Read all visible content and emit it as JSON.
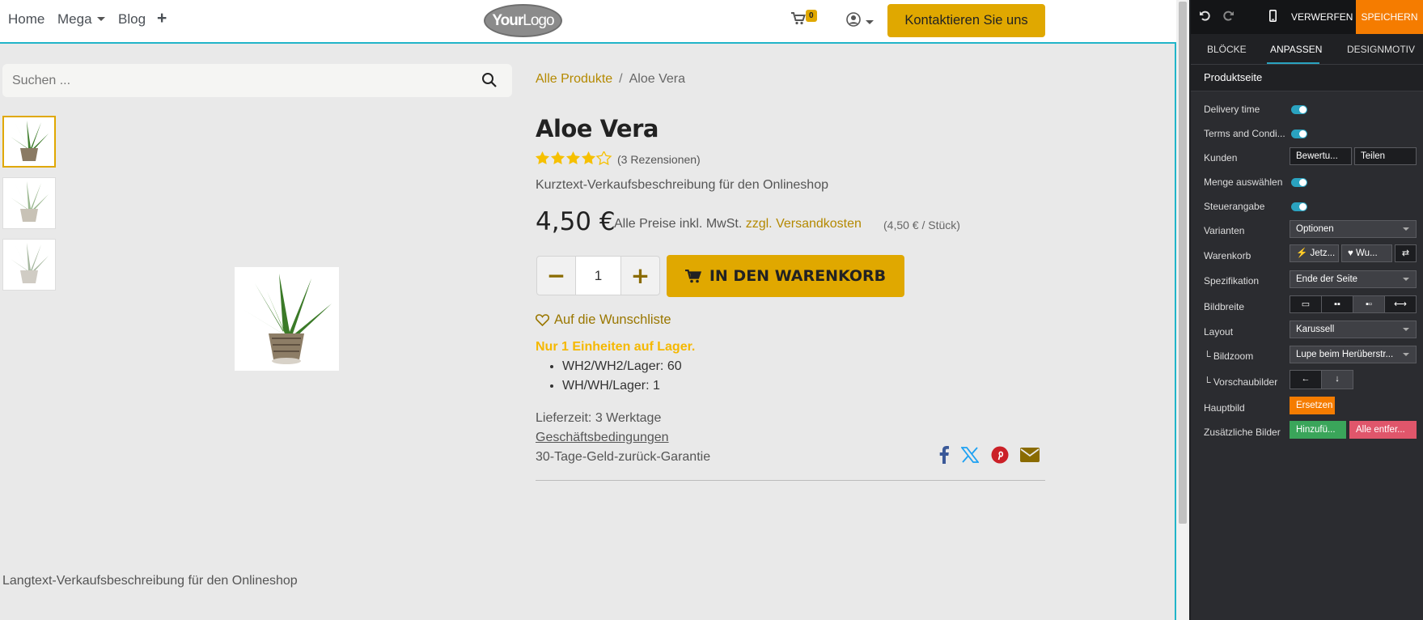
{
  "nav": {
    "home": "Home",
    "mega": "Mega",
    "blog": "Blog",
    "add": "+"
  },
  "logo": {
    "bold": "Your",
    "light": "Logo"
  },
  "cart_count": "0",
  "contact_button": "Kontaktieren Sie uns",
  "search": {
    "placeholder": "Suchen ..."
  },
  "breadcrumb": {
    "parent": "Alle Produkte",
    "separator": "/",
    "current": "Aloe Vera"
  },
  "product": {
    "name": "Aloe Vera",
    "rating": 4.5,
    "reviews": "(3 Rezensionen)",
    "short_description": "Kurztext-Verkaufsbeschreibung für den Onlineshop",
    "price": "4,50 €",
    "vat_prefix": "Alle Preise inkl. MwSt.",
    "shipping_link": "zzgl. Versandkosten",
    "unit_price": "(4,50 € / Stück)",
    "quantity": "1",
    "add_to_cart": "IN DEN WARENKORB",
    "wishlist": "Auf die Wunschliste",
    "stock_notice": "Nur 1 Einheiten auf Lager.",
    "stock_items": [
      "WH2/WH2/Lager: 60",
      "WH/WH/Lager: 1"
    ],
    "delivery": "Lieferzeit: 3 Werktage",
    "terms": "Geschäftsbedingungen",
    "guarantee": "30-Tage-Geld-zurück-Garantie",
    "long_description": "Langtext-Verkaufsbeschreibung für den Onlineshop"
  },
  "share_icons": [
    "facebook-icon",
    "x-icon",
    "pinterest-icon",
    "email-icon"
  ],
  "colors": {
    "accent": "#e0a800",
    "editor_accent": "#2aa3c0",
    "save": "#f57c00",
    "green": "#3aa55a",
    "red": "#e0566b"
  },
  "editor": {
    "discard": "VERWERFEN",
    "save": "SPEICHERN",
    "tabs": [
      "BLÖCKE",
      "ANPASSEN",
      "DESIGNMOTIV"
    ],
    "section_title": "Produktseite",
    "rows": {
      "delivery_time": "Delivery time",
      "terms": "Terms and Condi...",
      "customers": "Kunden",
      "customers_opts": [
        "Bewertu...",
        "Teilen"
      ],
      "select_qty": "Menge auswählen",
      "tax": "Steuerangabe",
      "variants": "Varianten",
      "variants_value": "Optionen",
      "cart": "Warenkorb",
      "cart_opts": [
        "Jetz...",
        "Wu..."
      ],
      "spec": "Spezifikation",
      "spec_value": "Ende der Seite",
      "image_width": "Bildbreite",
      "layout": "Layout",
      "layout_value": "Karussell",
      "zoom": "└ Bildzoom",
      "zoom_value": "Lupe beim Herüberstr...",
      "thumbs": "└ Vorschaubilder",
      "main_image": "Hauptbild",
      "replace": "Ersetzen",
      "extra_images": "Zusätzliche Bilder",
      "add": "Hinzufü...",
      "remove_all": "Alle entfer..."
    }
  }
}
